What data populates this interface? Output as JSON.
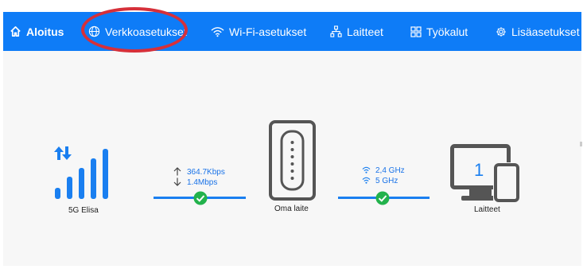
{
  "nav": {
    "home": "Aloitus",
    "network_settings": "Verkkoasetukset",
    "wifi_settings": "Wi-Fi-asetukset",
    "devices": "Laitteet",
    "tools": "Työkalut",
    "more_settings": "Lisäasetukset"
  },
  "status": {
    "operator_label": "5G Elisa",
    "upload_speed": "364.7Kbps",
    "download_speed": "1.4Mbps",
    "router_label": "Oma laite",
    "wifi_band_1": "2,4 GHz",
    "wifi_band_2": "5 GHz",
    "device_count": "1",
    "devices_label": "Laitteet"
  },
  "colors": {
    "nav_background": "#0e7cf7",
    "accent": "#1a7ff0",
    "ok_green": "#22b24c",
    "highlight_circle": "#d6303a"
  }
}
